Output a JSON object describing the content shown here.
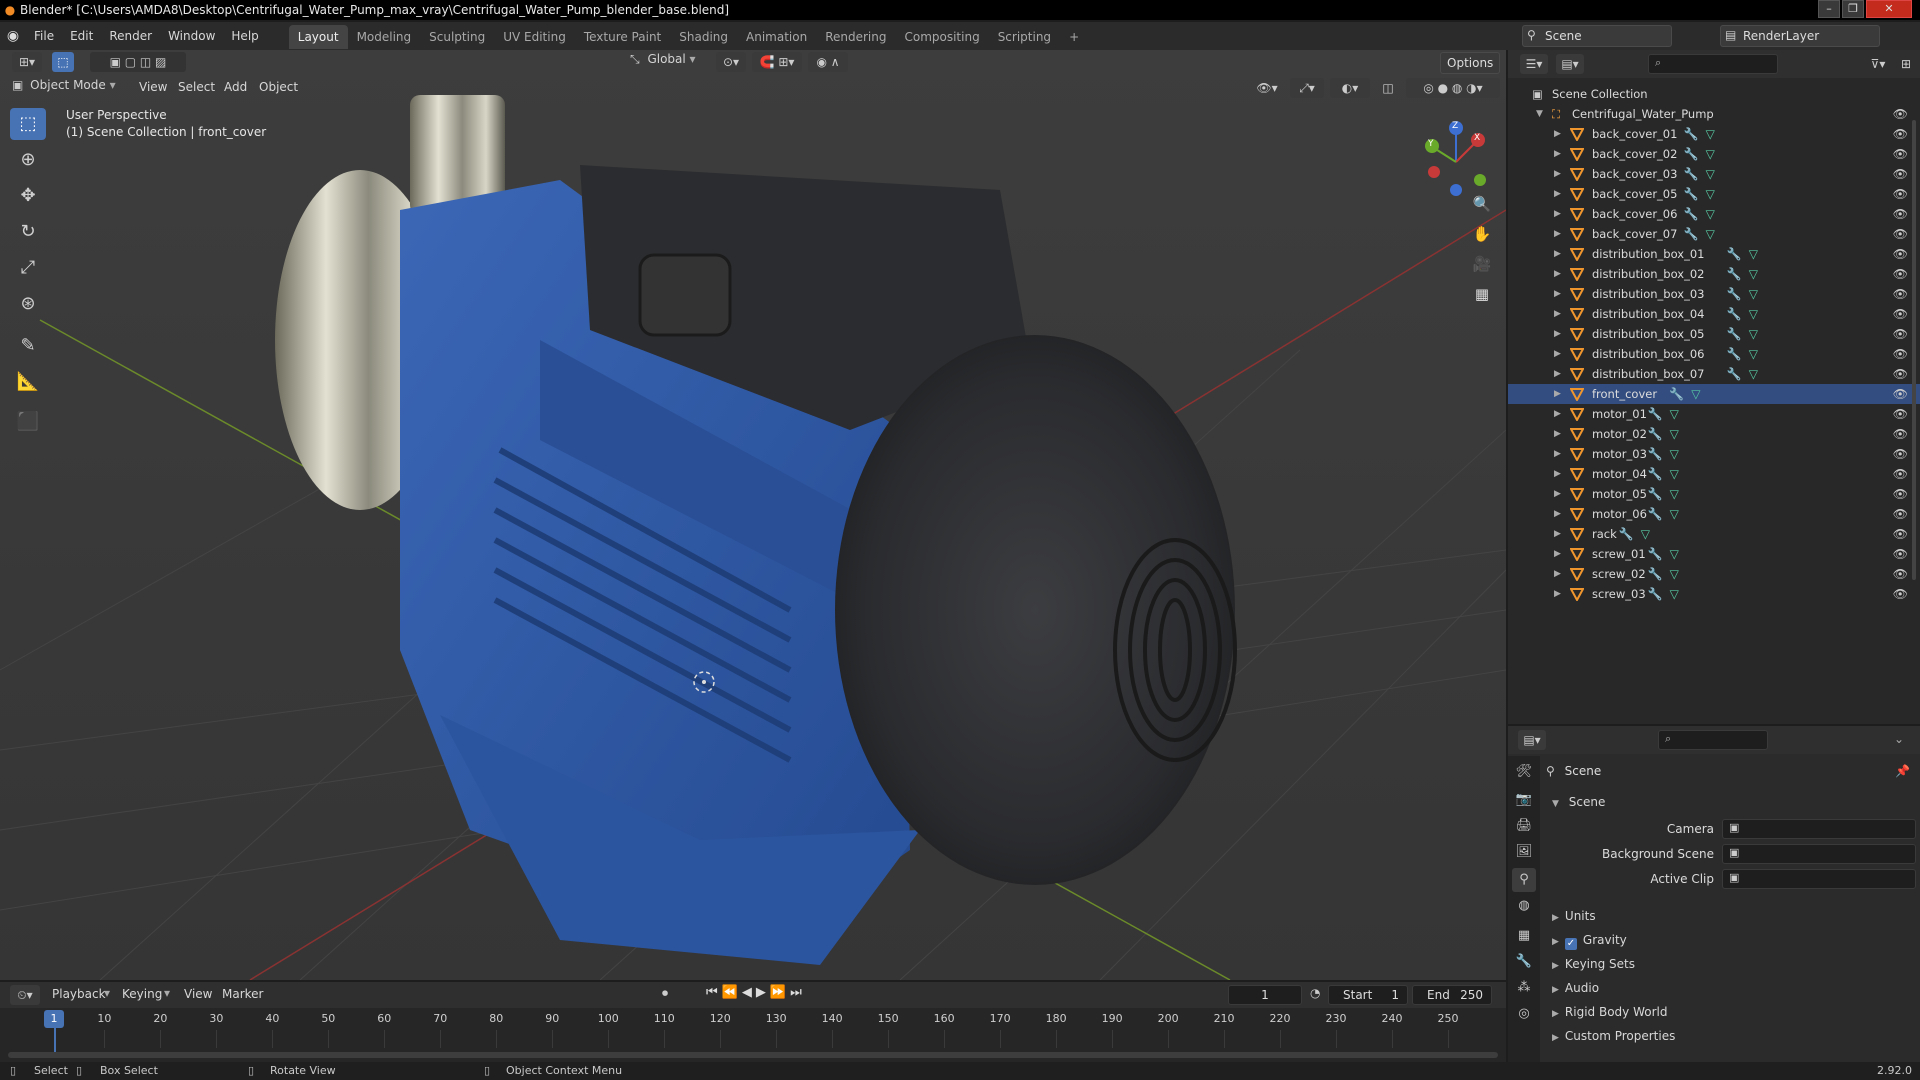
{
  "window": {
    "title": "Blender* [C:\\Users\\AMDA8\\Desktop\\Centrifugal_Water_Pump_max_vray\\Centrifugal_Water_Pump_blender_base.blend]"
  },
  "menu": [
    "File",
    "Edit",
    "Render",
    "Window",
    "Help"
  ],
  "workspaces": [
    "Layout",
    "Modeling",
    "Sculpting",
    "UV Editing",
    "Texture Paint",
    "Shading",
    "Animation",
    "Rendering",
    "Compositing",
    "Scripting"
  ],
  "add_workspace": "+",
  "scene": {
    "name": "Scene",
    "render_layer": "RenderLayer"
  },
  "viewport_header": {
    "transform_orientation": "Global",
    "options": "Options",
    "mode": "Object Mode",
    "menus": [
      "View",
      "Select",
      "Add",
      "Object"
    ]
  },
  "viewport": {
    "view_name": "User Perspective",
    "collection_info": "(1) Scene Collection | front_cover",
    "gizmo": {
      "z": "Z",
      "x": "X",
      "y": "Y"
    }
  },
  "outliner": {
    "root": "Scene Collection",
    "collection": "Centrifugal_Water_Pump",
    "selected": "front_cover",
    "items": [
      "back_cover_01",
      "back_cover_02",
      "back_cover_03",
      "back_cover_05",
      "back_cover_06",
      "back_cover_07",
      "distribution_box_01",
      "distribution_box_02",
      "distribution_box_03",
      "distribution_box_04",
      "distribution_box_05",
      "distribution_box_06",
      "distribution_box_07",
      "front_cover",
      "motor_01",
      "motor_02",
      "motor_03",
      "motor_04",
      "motor_05",
      "motor_06",
      "rack",
      "screw_01",
      "screw_02",
      "screw_03"
    ]
  },
  "properties": {
    "title": "Scene",
    "panel": "Scene",
    "fields": [
      {
        "label": "Camera",
        "value": ""
      },
      {
        "label": "Background Scene",
        "value": ""
      },
      {
        "label": "Active Clip",
        "value": ""
      }
    ],
    "sections": [
      {
        "label": "Units",
        "checkbox": false
      },
      {
        "label": "Gravity",
        "checkbox": true
      },
      {
        "label": "Keying Sets",
        "checkbox": false
      },
      {
        "label": "Audio",
        "checkbox": false
      },
      {
        "label": "Rigid Body World",
        "checkbox": false
      },
      {
        "label": "Custom Properties",
        "checkbox": false
      }
    ]
  },
  "timeline": {
    "menus": [
      "Playback",
      "Keying",
      "View",
      "Marker"
    ],
    "current_frame": "1",
    "start_label": "Start",
    "start": "1",
    "end_label": "End",
    "end": "250",
    "ruler": [
      "1",
      "10",
      "20",
      "30",
      "40",
      "50",
      "60",
      "70",
      "80",
      "90",
      "100",
      "110",
      "120",
      "130",
      "140",
      "150",
      "160",
      "170",
      "180",
      "190",
      "200",
      "210",
      "220",
      "230",
      "240",
      "250"
    ]
  },
  "statusbar": {
    "select": "Select",
    "box_select": "Box Select",
    "rotate": "Rotate View",
    "context": "Object Context Menu",
    "version": "2.92.0"
  },
  "colors": {
    "accent": "#4772b3",
    "pump_blue": "#2f5aa8",
    "selection": "#334d80",
    "orange": "#f08a24"
  }
}
